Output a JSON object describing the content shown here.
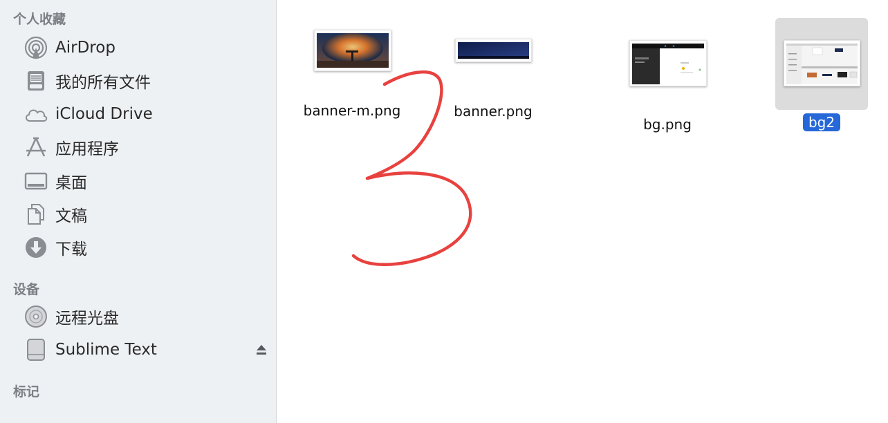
{
  "sidebar": {
    "favorites_header": "个人收藏",
    "favorites": [
      {
        "label": "AirDrop",
        "icon": "airdrop-icon"
      },
      {
        "label": "我的所有文件",
        "icon": "all-files-icon"
      },
      {
        "label": "iCloud Drive",
        "icon": "cloud-icon"
      },
      {
        "label": "应用程序",
        "icon": "applications-icon"
      },
      {
        "label": "桌面",
        "icon": "desktop-icon"
      },
      {
        "label": "文稿",
        "icon": "documents-icon"
      },
      {
        "label": "下载",
        "icon": "downloads-icon"
      }
    ],
    "devices_header": "设备",
    "devices": [
      {
        "label": "远程光盘",
        "icon": "disc-icon"
      },
      {
        "label": "Sublime Text",
        "icon": "drive-icon",
        "eject": true
      }
    ],
    "tags_header": "标记"
  },
  "files": [
    {
      "name": "banner-m.png",
      "thumb": "night-photo"
    },
    {
      "name": "banner.png",
      "thumb": "dark-blue-banner"
    },
    {
      "name": "bg.png",
      "thumb": "screenshot-dark-sidebar"
    },
    {
      "name": "bg2",
      "thumb": "screenshot-finder",
      "selected": true
    }
  ],
  "colors": {
    "selection": "#2668d8",
    "annotation_stroke": "#e8423f",
    "sidebar_bg": "#eef1f4"
  }
}
